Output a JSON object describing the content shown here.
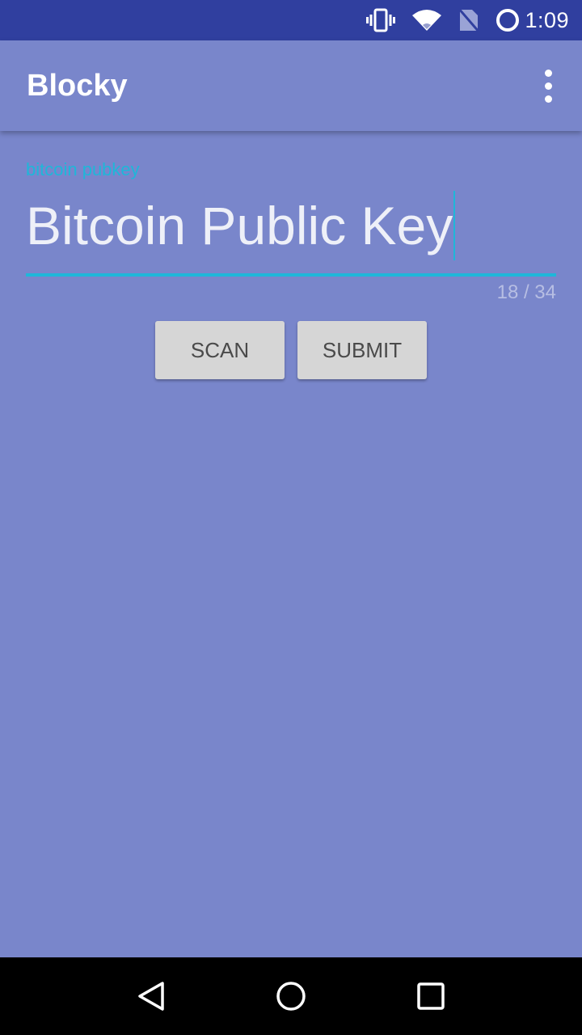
{
  "status_bar": {
    "time": "1:09",
    "icons": [
      "vibrate-icon",
      "wifi-icon",
      "no-sim-icon",
      "loading-icon"
    ]
  },
  "app_bar": {
    "title": "Blocky",
    "menu_icon": "more-vert-icon"
  },
  "form": {
    "field_label": "bitcoin pubkey",
    "field_value": "Bitcoin Public Key",
    "char_counter": "18 / 34",
    "accent_color": "#1eb7d9"
  },
  "actions": {
    "scan_label": "SCAN",
    "submit_label": "SUBMIT"
  },
  "nav_bar": {
    "icons": [
      "back-icon",
      "home-icon",
      "recents-icon"
    ]
  },
  "colors": {
    "status_bar": "#303f9f",
    "background": "#7986cb",
    "button": "#d6d6d6"
  }
}
